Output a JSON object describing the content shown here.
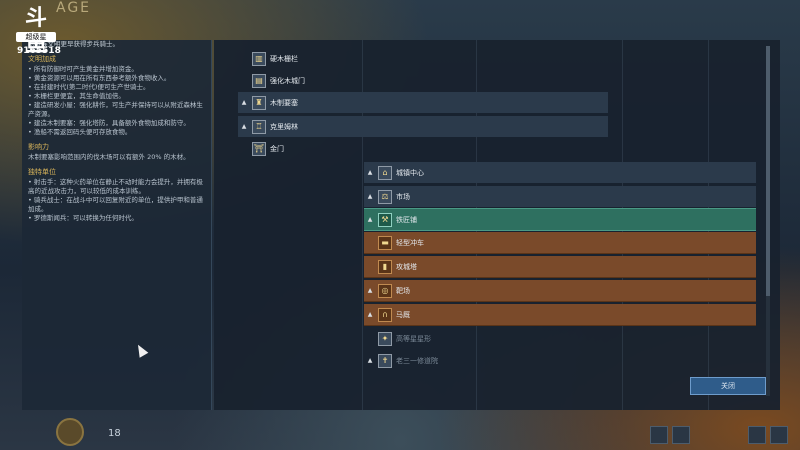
{
  "overlay": {
    "logo_text": "斗鱼",
    "logo_sub": "超级星",
    "room_id": "9165518",
    "age_title": "AGE"
  },
  "left_panel": {
    "intro": "…贵族文明更早获得步兵骑士。",
    "sections": [
      {
        "heading": "文明加成",
        "bullets": [
          "• 所有防御时可产生黄金并增加资金。",
          "• 黄金资源可以用在所有东西参考额外食物收入。",
          "• 在封建时代(第二时代)便可生产世骑士。",
          "• 木栅栏更便宜，其生命值加倍。",
          "• 建造研发小屋：强化耕作，可生产并保持可以从附近森林生产资源。",
          "• 建造木制要塞：强化塔防，具备额外食物加成和防守。",
          "• 渔船不需返回码头便可存放食物。"
        ]
      },
      {
        "heading": "影响力",
        "bullets": [
          "木制要塞影响范围内的伐木场可以有额外 20% 的木材。"
        ]
      },
      {
        "heading": "独特单位",
        "bullets": [
          "• 射击手：这种火药单位在静止不动时能力会提升，并拥有极高的近战攻击力，可以较低的成本训练。",
          "• 骑兵战士：在战斗中可以回复附近的单位，提供护甲和普通加成。",
          "• 罗德斯闻兵：可以转换为任何时代。"
        ]
      }
    ]
  },
  "tree_rows": [
    {
      "label": "硬木栅栏",
      "icon": "palisade-icon",
      "style": "plain",
      "arrow": "",
      "indent": 0
    },
    {
      "label": "强化木城门",
      "icon": "gate-icon",
      "style": "plain",
      "arrow": "",
      "indent": 0
    },
    {
      "label": "木制要塞",
      "icon": "fortress-icon",
      "style": "stripe",
      "arrow": "▲",
      "indent": 0
    },
    {
      "label": "克里姆林",
      "icon": "kremlin-icon",
      "style": "stripe",
      "arrow": "▲",
      "indent": 0
    },
    {
      "label": "金门",
      "icon": "golden-gate-icon",
      "style": "plain",
      "arrow": "",
      "indent": 0
    },
    {
      "label": "城镇中心",
      "icon": "town-center-icon",
      "style": "stripe",
      "arrow": "▲",
      "indent": 1
    },
    {
      "label": "市场",
      "icon": "market-icon",
      "style": "stripe",
      "arrow": "▲",
      "indent": 1
    },
    {
      "label": "铁匠铺",
      "icon": "blacksmith-icon",
      "style": "green",
      "arrow": "▲",
      "indent": 1
    },
    {
      "label": "轻型冲车",
      "icon": "ram-icon",
      "style": "orange",
      "arrow": "",
      "indent": 1
    },
    {
      "label": "攻城塔",
      "icon": "siege-tower-icon",
      "style": "orange",
      "arrow": "",
      "indent": 1
    },
    {
      "label": "靶场",
      "icon": "range-icon",
      "style": "orange",
      "arrow": "▲",
      "indent": 1
    },
    {
      "label": "马厩",
      "icon": "stable-icon",
      "style": "orange",
      "arrow": "▲",
      "indent": 1
    },
    {
      "label": "高等星星形",
      "icon": "star-fort-icon",
      "style": "dim",
      "arrow": "",
      "indent": 1
    },
    {
      "label": "老三一修道院",
      "icon": "monastery-icon",
      "style": "dim",
      "arrow": "▲",
      "indent": 1
    }
  ],
  "confirm_label": "关闭",
  "hud": {
    "counter": "18"
  }
}
